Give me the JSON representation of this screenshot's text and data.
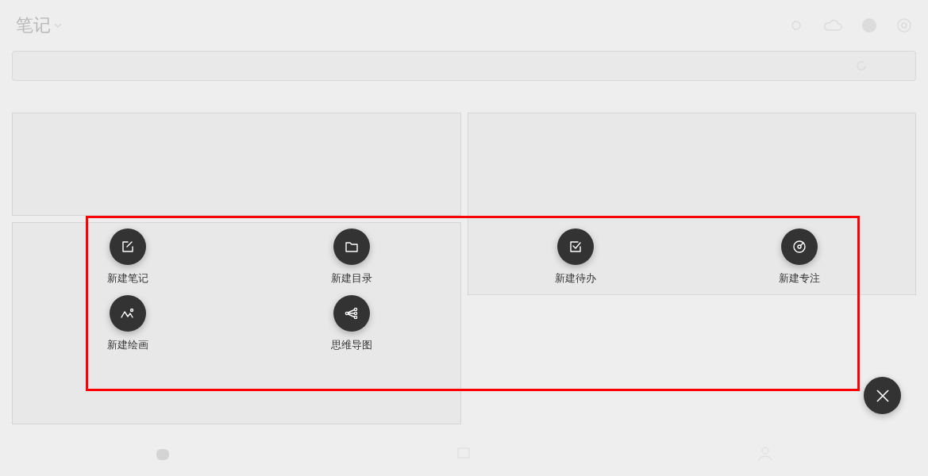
{
  "header": {
    "title": "笔记"
  },
  "actions": [
    {
      "label": "新建笔记",
      "kind": "note"
    },
    {
      "label": "新建目录",
      "kind": "folder"
    },
    {
      "label": "新建待办",
      "kind": "todo"
    },
    {
      "label": "新建专注",
      "kind": "focus"
    },
    {
      "label": "新建绘画",
      "kind": "drawing"
    },
    {
      "label": "思维导图",
      "kind": "mindmap"
    }
  ]
}
